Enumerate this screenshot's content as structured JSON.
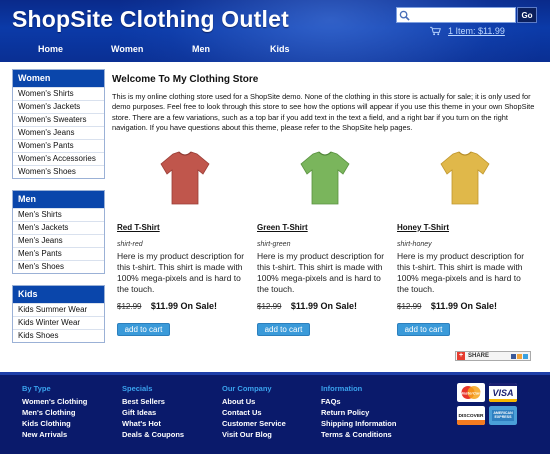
{
  "header": {
    "site_title": "ShopSite Clothing Outlet",
    "search": {
      "placeholder": "",
      "value": "",
      "go_label": "Go"
    },
    "cart_label": "1 Item: $11.99",
    "nav": [
      "Home",
      "Women",
      "Men",
      "Kids"
    ]
  },
  "sidebar": {
    "sections": [
      {
        "title": "Women",
        "items": [
          "Women's Shirts",
          "Women's Jackets",
          "Women's Sweaters",
          "Women's Jeans",
          "Women's Pants",
          "Women's Accessories",
          "Women's Shoes"
        ]
      },
      {
        "title": "Men",
        "items": [
          "Men's Shirts",
          "Men's Jackets",
          "Men's Jeans",
          "Men's Pants",
          "Men's Shoes"
        ]
      },
      {
        "title": "Kids",
        "items": [
          "Kids Summer Wear",
          "Kids Winter Wear",
          "Kids Shoes"
        ]
      }
    ]
  },
  "main": {
    "title": "Welcome To My Clothing Store",
    "intro": "This is my online clothing store used for a ShopSite demo. None of the clothing in this store is actually for sale; it is only used for demo purposes. Feel free to look through this store to see how the options will appear if you use this theme in your own ShopSite store. There are a few variations, such as a top bar if you add text in the text a field, and a right bar if you turn on the right navigation. If you have questions about this theme, please refer to the ShopSite help pages.",
    "products": [
      {
        "name": "Red T-Shirt",
        "sku": "shirt-red",
        "desc": "Here is my product description for this t-shirt. This shirt is made with 100% mega-pixels and is hard to the touch.",
        "old_price": "$12.99",
        "sale": "$11.99 On Sale!",
        "button": "add to cart",
        "color": "#c0564c"
      },
      {
        "name": "Green T-Shirt",
        "sku": "shirt-green",
        "desc": "Here is my product description for this t-shirt. This shirt is made with 100% mega-pixels and is hard to the touch.",
        "old_price": "$12.99",
        "sale": "$11.99 On Sale!",
        "button": "add to cart",
        "color": "#7ab55c"
      },
      {
        "name": "Honey T-Shirt",
        "sku": "shirt-honey",
        "desc": "Here is my product description for this t-shirt. This shirt is made with 100% mega-pixels and is hard to the touch.",
        "old_price": "$12.99",
        "sale": "$11.99 On Sale!",
        "button": "add to cart",
        "color": "#e0b84a"
      }
    ],
    "share_label": "SHARE"
  },
  "footer": {
    "columns": [
      {
        "title": "By Type",
        "links": [
          "Women's Clothing",
          "Men's Clothing",
          "Kids Clothing",
          "New Arrivals"
        ]
      },
      {
        "title": "Specials",
        "links": [
          "Best Sellers",
          "Gift Ideas",
          "What's Hot",
          "Deals & Coupons"
        ]
      },
      {
        "title": "Our Company",
        "links": [
          "About Us",
          "Contact Us",
          "Customer Service",
          "Visit Our Blog"
        ]
      },
      {
        "title": "Information",
        "links": [
          "FAQs",
          "Return Policy",
          "Shipping Information",
          "Terms & Conditions"
        ]
      }
    ],
    "cards": [
      "MasterCard",
      "VISA",
      "DISCOVER",
      "AMERICAN EXPRESS"
    ]
  },
  "colors": {
    "header_bg": "#0b3aa8",
    "sidebar_head": "#0a46ab",
    "footer_bg": "#0a1a6b",
    "footer_heading": "#3aa3ee",
    "button": "#3a9ad9"
  }
}
